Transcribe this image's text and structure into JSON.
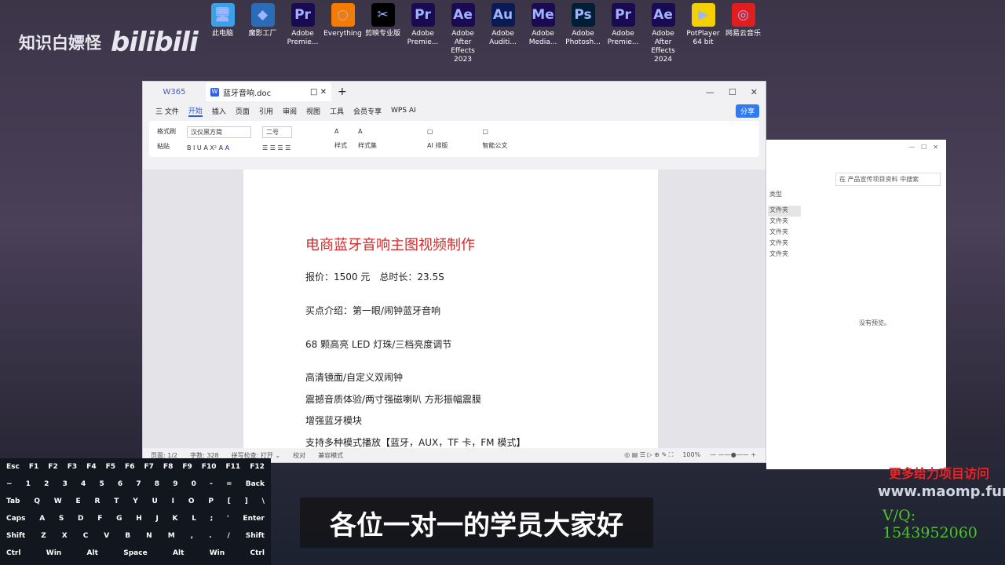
{
  "brand": {
    "name": "知识白嫖怪",
    "logo": "bilibili"
  },
  "desktop_icons": [
    {
      "label": "此电脑",
      "glyph": "🖥",
      "color": "#3aa0e8"
    },
    {
      "label": "魔影工厂",
      "glyph": "◆",
      "color": "#2b6cb8"
    },
    {
      "label": "Adobe Premie...",
      "glyph": "Pr",
      "color": "#1a0a52"
    },
    {
      "label": "Everything",
      "glyph": "○",
      "color": "#f57c00"
    },
    {
      "label": "剪映专业版",
      "glyph": "✂",
      "color": "#000000"
    },
    {
      "label": "Adobe Premie...",
      "glyph": "Pr",
      "color": "#1a0a52"
    },
    {
      "label": "Adobe After Effects 2023",
      "glyph": "Ae",
      "color": "#1a0a52"
    },
    {
      "label": "Adobe Auditi...",
      "glyph": "Au",
      "color": "#0a1a52"
    },
    {
      "label": "Adobe Media...",
      "glyph": "Me",
      "color": "#1a0a52"
    },
    {
      "label": "Adobe Photosh...",
      "glyph": "Ps",
      "color": "#001e36"
    },
    {
      "label": "Adobe Premie...",
      "glyph": "Pr",
      "color": "#1a0a52"
    },
    {
      "label": "Adobe After Effects 2024",
      "glyph": "Ae",
      "color": "#1a0a52"
    },
    {
      "label": "PotPlayer 64 bit",
      "glyph": "▶",
      "color": "#f5d000"
    },
    {
      "label": "网易云音乐",
      "glyph": "◎",
      "color": "#e01e1e"
    }
  ],
  "wps": {
    "app_tab": "W365",
    "doc_tab": "蓝牙音响.doc",
    "menu": [
      "三 文件",
      "开始",
      "插入",
      "页面",
      "引用",
      "审阅",
      "视图",
      "工具",
      "会员专享",
      "WPS AI"
    ],
    "share": "分享",
    "ribbon": {
      "format_painter": "格式刷",
      "paste": "粘贴",
      "font": "汉仪黑方简",
      "size": "二号",
      "styles": "样式",
      "style_set": "样式集",
      "ai_layout": "AI 排版",
      "smart_doc": "智能公文"
    },
    "document": {
      "title": "电商蓝牙音响主图视频制作",
      "lines": [
        "报价：1500 元　总时长：23.5S",
        "买点介绍：第一眼/闹钟蓝牙音响",
        "68 颗高亮 LED 灯珠/三档亮度调节",
        "高清镜面/自定义双闹钟",
        "震撼音质体验/两寸强磁喇叭 方形振幅震膜",
        "增强蓝牙模块",
        "支持多种模式播放【蓝牙，AUX，TF 卡，FM 模式】"
      ]
    },
    "status": {
      "page": "页面: 1/2",
      "words": "字数: 328",
      "spell": "拼写检查: 打开 ⌄",
      "proof": "校对",
      "compat": "兼容模式",
      "zoom": "100%"
    }
  },
  "explorer": {
    "search_placeholder": "在 产品宣传项目资料 中搜索",
    "type_header": "类型",
    "items": [
      "文件夹",
      "文件夹",
      "文件夹",
      "文件夹",
      "文件夹"
    ],
    "no_preview": "没有预览。"
  },
  "keyboard": [
    [
      "Esc",
      "F1",
      "F2",
      "F3",
      "F4",
      "F5",
      "F6",
      "F7",
      "F8",
      "F9",
      "F10",
      "F11",
      "F12"
    ],
    [
      "~",
      "1",
      "2",
      "3",
      "4",
      "5",
      "6",
      "7",
      "8",
      "9",
      "0",
      "-",
      "=",
      "Back"
    ],
    [
      "Tab",
      "Q",
      "W",
      "E",
      "R",
      "T",
      "Y",
      "U",
      "I",
      "O",
      "P",
      "[",
      "]",
      "\\"
    ],
    [
      "Caps",
      "A",
      "S",
      "D",
      "F",
      "G",
      "H",
      "J",
      "K",
      "L",
      ";",
      "'",
      "Enter"
    ],
    [
      "Shift",
      "Z",
      "X",
      "C",
      "V",
      "B",
      "N",
      "M",
      ",",
      ".",
      "/",
      "Shift"
    ],
    [
      "Ctrl",
      "Win",
      "Alt",
      "Space",
      "Alt",
      "Win",
      "Ctrl"
    ]
  ],
  "subtitle": "各位一对一的学员大家好",
  "watermark": {
    "line1": "更多给力项目访问",
    "line2": "www.maomp.fun",
    "line3": "V/Q: 1543952060"
  }
}
